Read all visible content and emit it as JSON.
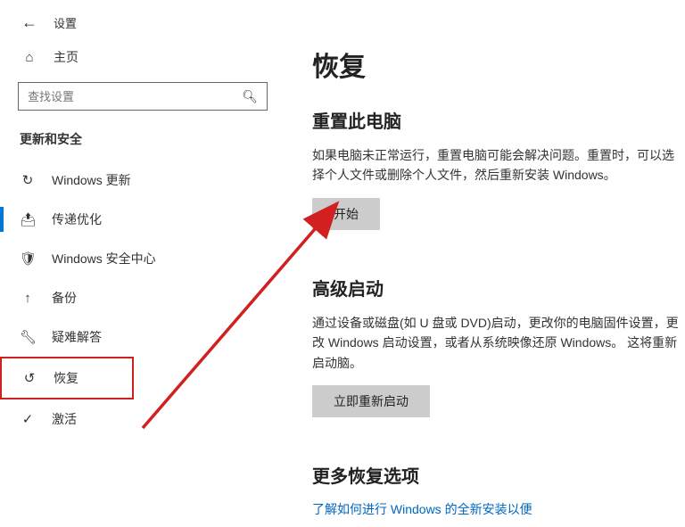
{
  "header": {
    "title": "设置"
  },
  "home": {
    "label": "主页"
  },
  "search": {
    "placeholder": "查找设置"
  },
  "category": {
    "title": "更新和安全"
  },
  "nav": {
    "items": [
      {
        "label": "Windows 更新"
      },
      {
        "label": "传递优化"
      },
      {
        "label": "Windows 安全中心"
      },
      {
        "label": "备份"
      },
      {
        "label": "疑难解答"
      },
      {
        "label": "恢复"
      },
      {
        "label": "激活"
      }
    ]
  },
  "main": {
    "title": "恢复",
    "reset": {
      "title": "重置此电脑",
      "desc": "如果电脑未正常运行，重置电脑可能会解决问题。重置时，可以选择个人文件或删除个人文件，然后重新安装 Windows。",
      "button": "开始"
    },
    "advanced": {
      "title": "高级启动",
      "desc": "通过设备或磁盘(如 U 盘或 DVD)启动，更改你的电脑固件设置，更改 Windows 启动设置，或者从系统映像还原 Windows。 这将重新启动脑。",
      "button": "立即重新启动"
    },
    "more": {
      "title": "更多恢复选项",
      "link": "了解如何进行 Windows 的全新安装以便"
    }
  }
}
